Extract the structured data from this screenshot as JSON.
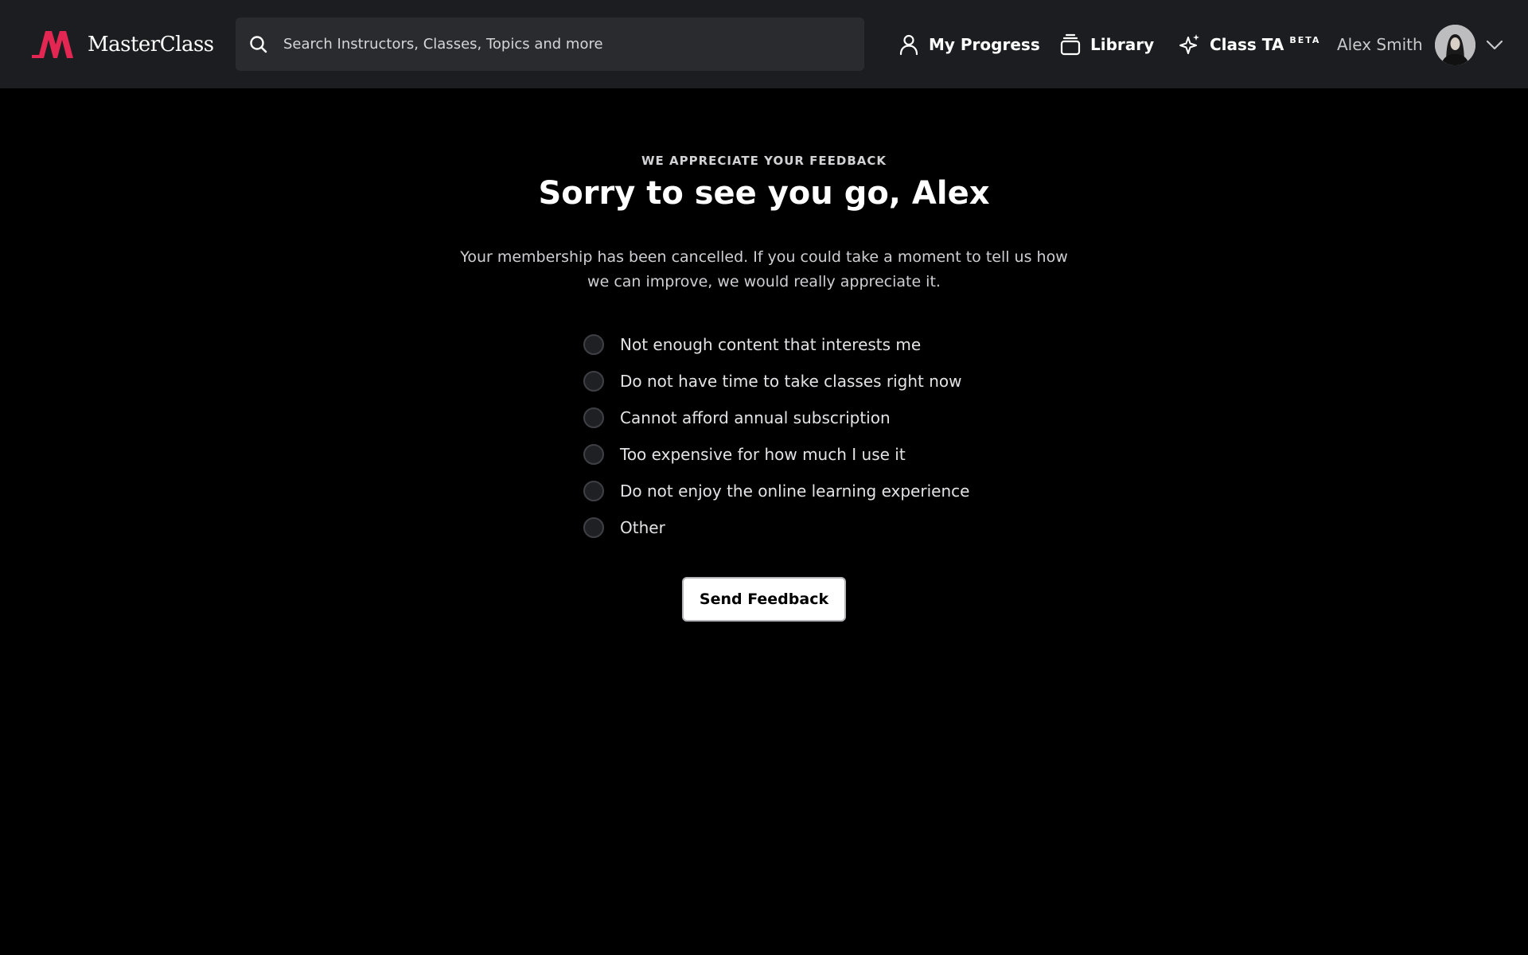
{
  "header": {
    "logo_text": "MasterClass",
    "brand_color": "#e32652",
    "search": {
      "placeholder": "Search Instructors, Classes, Topics and more",
      "value": ""
    },
    "nav": {
      "progress_label": "My Progress",
      "library_label": "Library",
      "classta_label": "Class TA",
      "classta_badge": "BETA"
    },
    "user": {
      "name": "Alex Smith"
    }
  },
  "icons": {
    "search": "search-icon",
    "progress": "person-icon",
    "library": "stack-icon",
    "classta": "sparkle-icon",
    "dropdown": "chevron-down-icon"
  },
  "main": {
    "eyebrow": "WE APPRECIATE YOUR FEEDBACK",
    "title": "Sorry to see you go, Alex",
    "subtitle": "Your membership has been cancelled. If you could take a moment to tell us how we can improve, we would really appreciate it.",
    "options": [
      {
        "label": "Not enough content that interests me",
        "selected": false
      },
      {
        "label": "Do not have time to take classes right now",
        "selected": false
      },
      {
        "label": "Cannot afford annual subscription",
        "selected": false
      },
      {
        "label": "Too expensive for how much I use it",
        "selected": false
      },
      {
        "label": "Do not enjoy the online learning experience",
        "selected": false
      },
      {
        "label": "Other",
        "selected": false
      }
    ],
    "submit_label": "Send Feedback"
  }
}
